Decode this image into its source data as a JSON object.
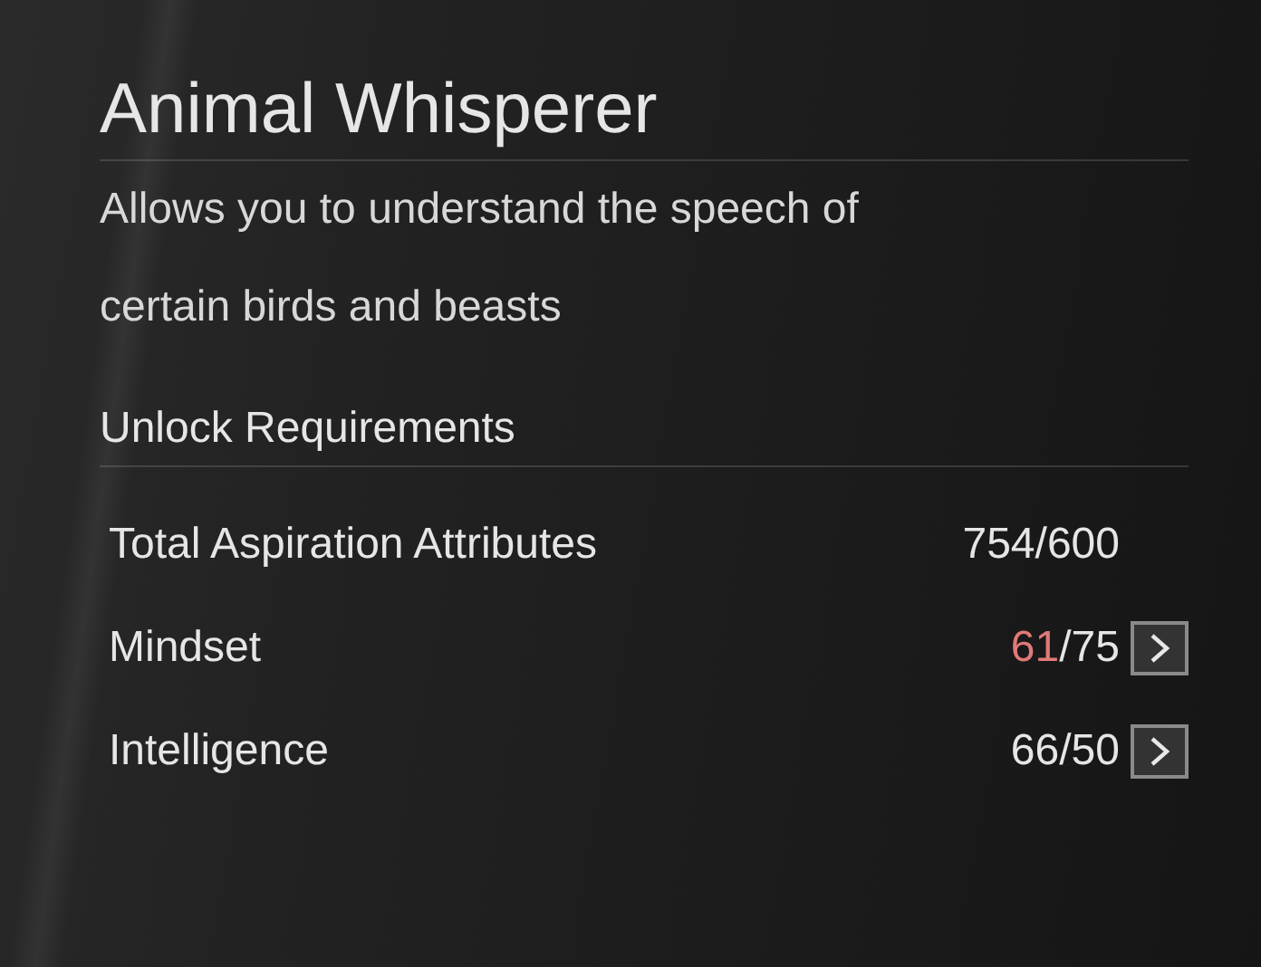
{
  "title": "Animal Whisperer",
  "description": "Allows you to understand the speech of certain birds and beasts",
  "requirements_heading": "Unlock Requirements",
  "requirements": [
    {
      "label": "Total Aspiration Attributes",
      "current": "754",
      "separator": "/",
      "required": "600",
      "met": true,
      "navigable": false
    },
    {
      "label": "Mindset",
      "current": "61",
      "separator": "/",
      "required": "75",
      "met": false,
      "navigable": true
    },
    {
      "label": "Intelligence",
      "current": "66",
      "separator": "/",
      "required": "50",
      "met": true,
      "navigable": true
    }
  ]
}
